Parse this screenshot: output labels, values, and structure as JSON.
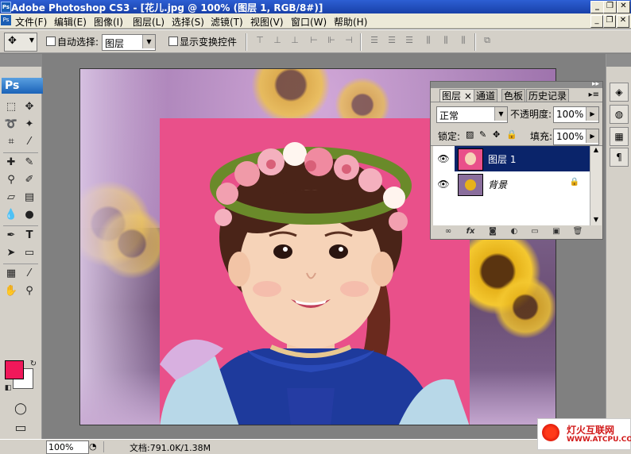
{
  "window": {
    "title": "Adobe Photoshop CS3 - [花儿.jpg @ 100% (图层 1, RGB/8#)]",
    "logo": "Ps"
  },
  "menu": {
    "items": [
      "文件(F)",
      "编辑(E)",
      "图像(I)",
      "图层(L)",
      "选择(S)",
      "滤镜(T)",
      "视图(V)",
      "窗口(W)",
      "帮助(H)"
    ]
  },
  "options": {
    "auto_select_label": "自动选择:",
    "auto_select_value": "图层",
    "show_transform_label": "显示变换控件"
  },
  "toolbox": {
    "logo": "Ps",
    "foreground_color": "#f0185a",
    "background_color": "#ffffff"
  },
  "layers_panel": {
    "tabs": [
      "图层",
      "通道",
      "色板",
      "历史记录"
    ],
    "blend_mode": "正常",
    "opacity_label": "不透明度:",
    "opacity_value": "100%",
    "lock_label": "锁定:",
    "fill_label": "填充:",
    "fill_value": "100%",
    "layers": [
      {
        "name": "图层 1",
        "selected": true,
        "visible": true
      },
      {
        "name": "背景",
        "selected": false,
        "visible": true,
        "locked": true
      }
    ]
  },
  "status": {
    "zoom": "100%",
    "doc_info": "文档:791.0K/1.38M"
  },
  "watermark": {
    "line1": "灯火互联网",
    "line2": "WWW.ATCPU.COM"
  }
}
